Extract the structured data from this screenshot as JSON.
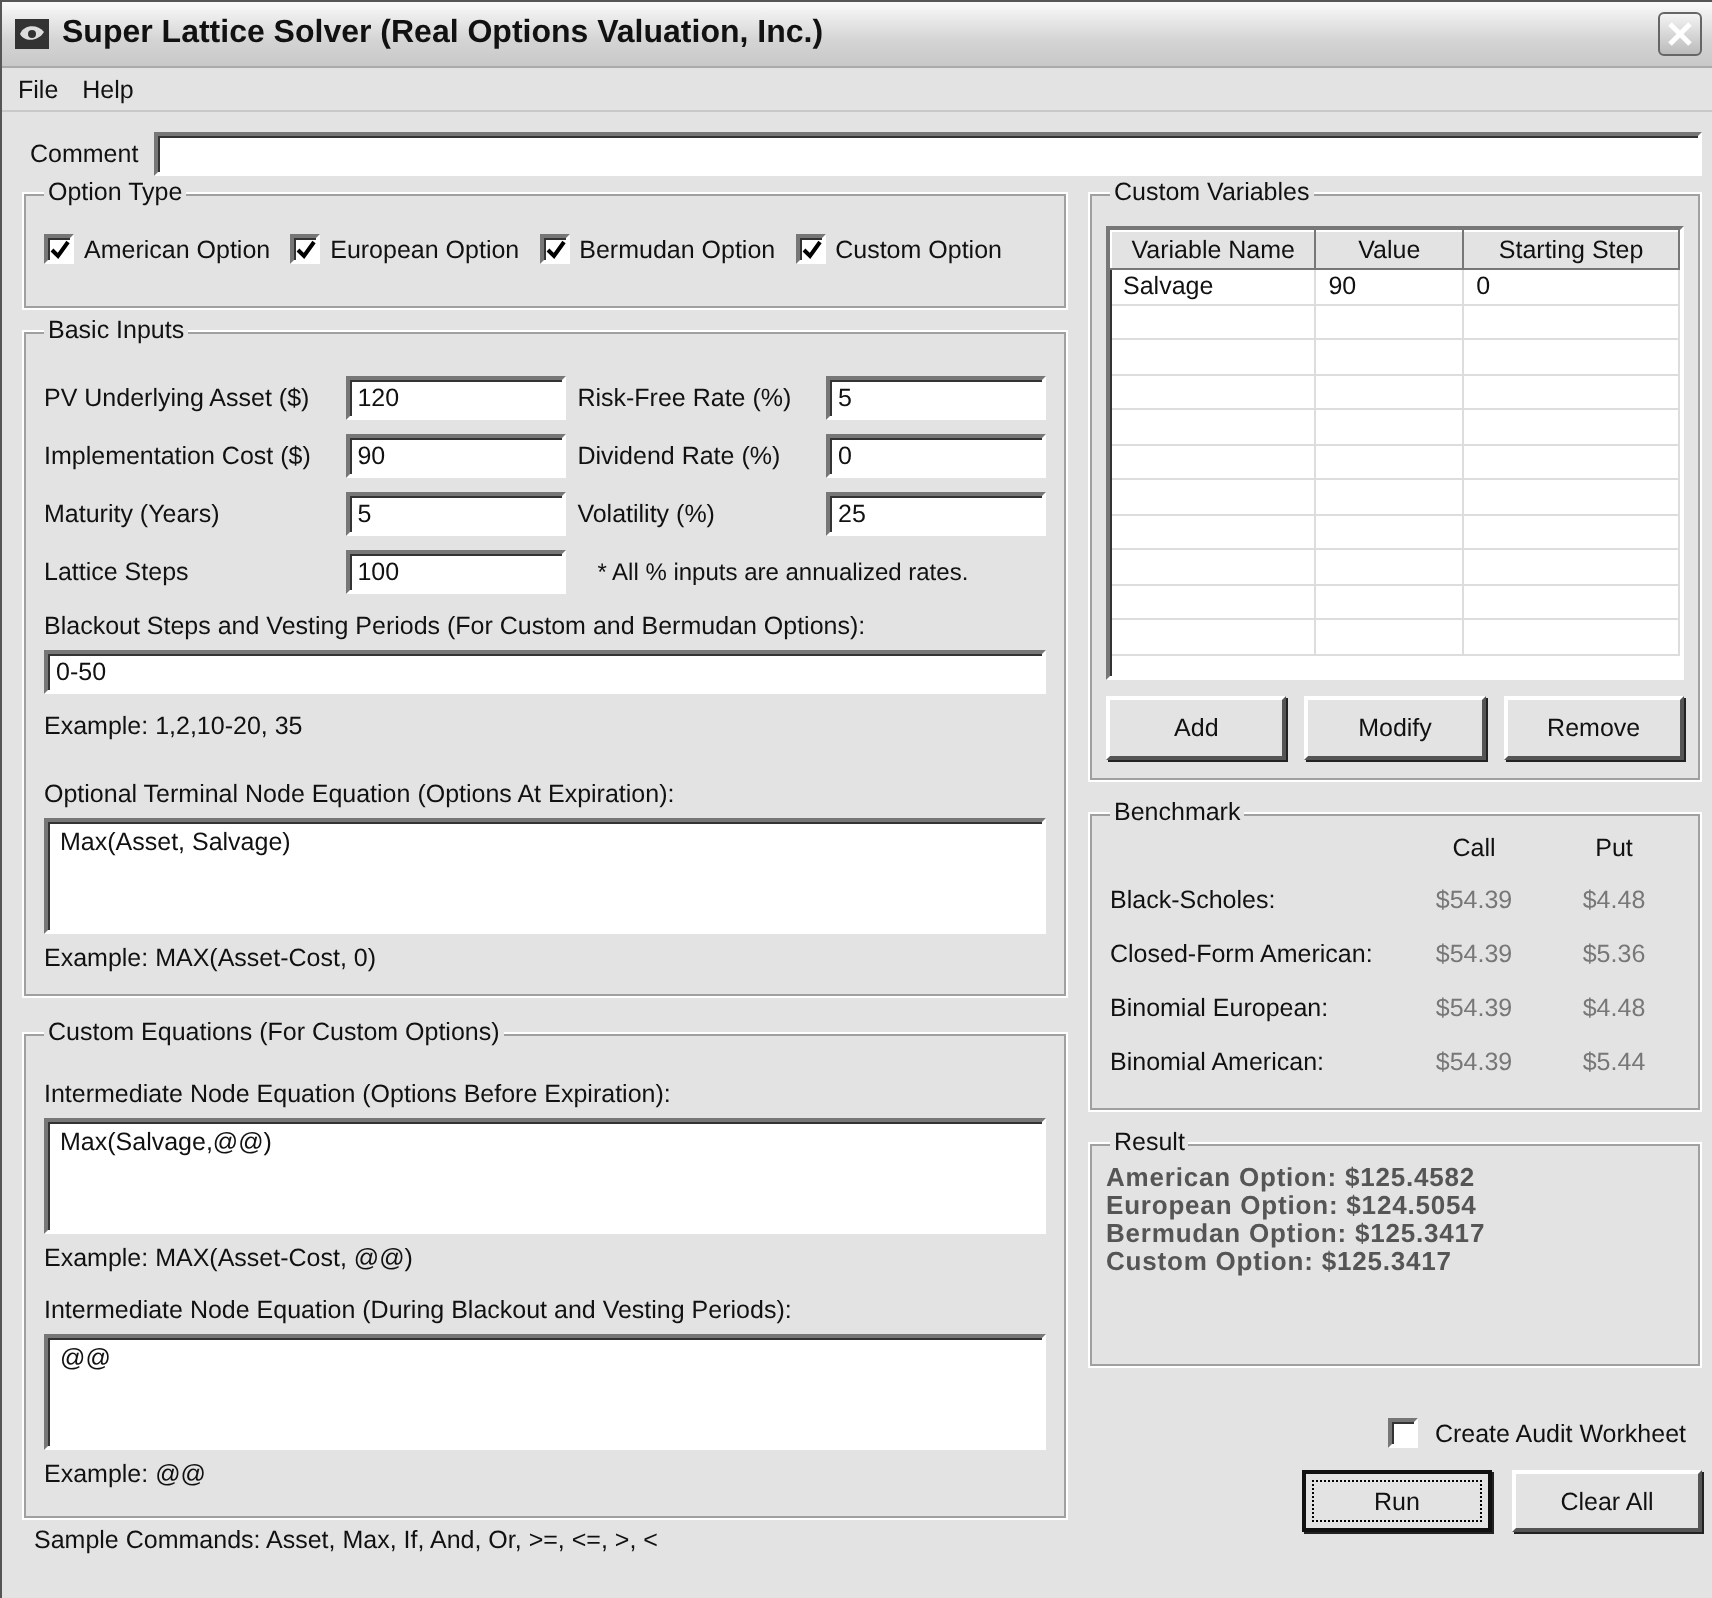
{
  "window": {
    "title": "Super Lattice Solver (Real Options Valuation, Inc.)"
  },
  "menu": [
    "File",
    "Help"
  ],
  "comment": {
    "label": "Comment"
  },
  "option_type": {
    "title": "Option Type",
    "options": [
      {
        "label": "American Option",
        "checked": true
      },
      {
        "label": "European Option",
        "checked": true
      },
      {
        "label": "Bermudan Option",
        "checked": true
      },
      {
        "label": "Custom Option",
        "checked": true
      }
    ]
  },
  "basic_inputs": {
    "title": "Basic Inputs",
    "fields": [
      {
        "label": "PV Underlying Asset ($)",
        "value": "120"
      },
      {
        "label": "Risk-Free Rate (%)",
        "value": "5"
      },
      {
        "label": "Implementation Cost ($)",
        "value": "90"
      },
      {
        "label": "Dividend Rate (%)",
        "value": "0"
      },
      {
        "label": "Maturity (Years)",
        "value": "5"
      },
      {
        "label": "Volatility (%)",
        "value": "25"
      },
      {
        "label": "Lattice Steps",
        "value": "100"
      }
    ],
    "note": "* All % inputs are annualized rates.",
    "blackout": {
      "label": "Blackout Steps and Vesting Periods (For Custom and Bermudan Options):",
      "value": "0-50",
      "example": "Example: 1,2,10-20, 35"
    },
    "terminal": {
      "label": "Optional Terminal Node Equation (Options At Expiration):",
      "value": "Max(Asset, Salvage)",
      "example": "Example: MAX(Asset-Cost, 0)"
    }
  },
  "custom_equations": {
    "title": "Custom Equations (For Custom Options)",
    "equations": [
      {
        "label": "Intermediate Node Equation (Options Before Expiration):",
        "value": "Max(Salvage,@@)",
        "example": "Example: MAX(Asset-Cost, @@)"
      },
      {
        "label": "Intermediate Node Equation (During Blackout and Vesting Periods):",
        "value": "@@",
        "example": "Example: @@"
      }
    ]
  },
  "sample_commands": "Sample Commands: Asset, Max, If, And, Or, >=, <=, >, <",
  "custom_variables": {
    "title": "Custom Variables",
    "columns": [
      "Variable Name",
      "Value",
      "Starting Step"
    ],
    "rows": [
      [
        "Salvage",
        "90",
        "0"
      ]
    ],
    "buttons": [
      "Add",
      "Modify",
      "Remove"
    ]
  },
  "benchmark": {
    "title": "Benchmark",
    "columns": [
      "Call",
      "Put"
    ],
    "rows": [
      {
        "label": "Black-Scholes:",
        "call": "$54.39",
        "put": "$4.48"
      },
      {
        "label": "Closed-Form American:",
        "call": "$54.39",
        "put": "$5.36"
      },
      {
        "label": "Binomial European:",
        "call": "$54.39",
        "put": "$4.48"
      },
      {
        "label": "Binomial American:",
        "call": "$54.39",
        "put": "$5.44"
      }
    ]
  },
  "result": {
    "title": "Result",
    "lines": [
      "American Option: $125.4582",
      "European Option: $124.5054",
      "Bermudan Option: $125.3417",
      "Custom Option: $125.3417"
    ]
  },
  "audit": {
    "label": "Create Audit Workheet",
    "checked": false
  },
  "buttons": [
    {
      "label": "Run",
      "default": true
    },
    {
      "label": "Clear All",
      "default": false
    }
  ]
}
